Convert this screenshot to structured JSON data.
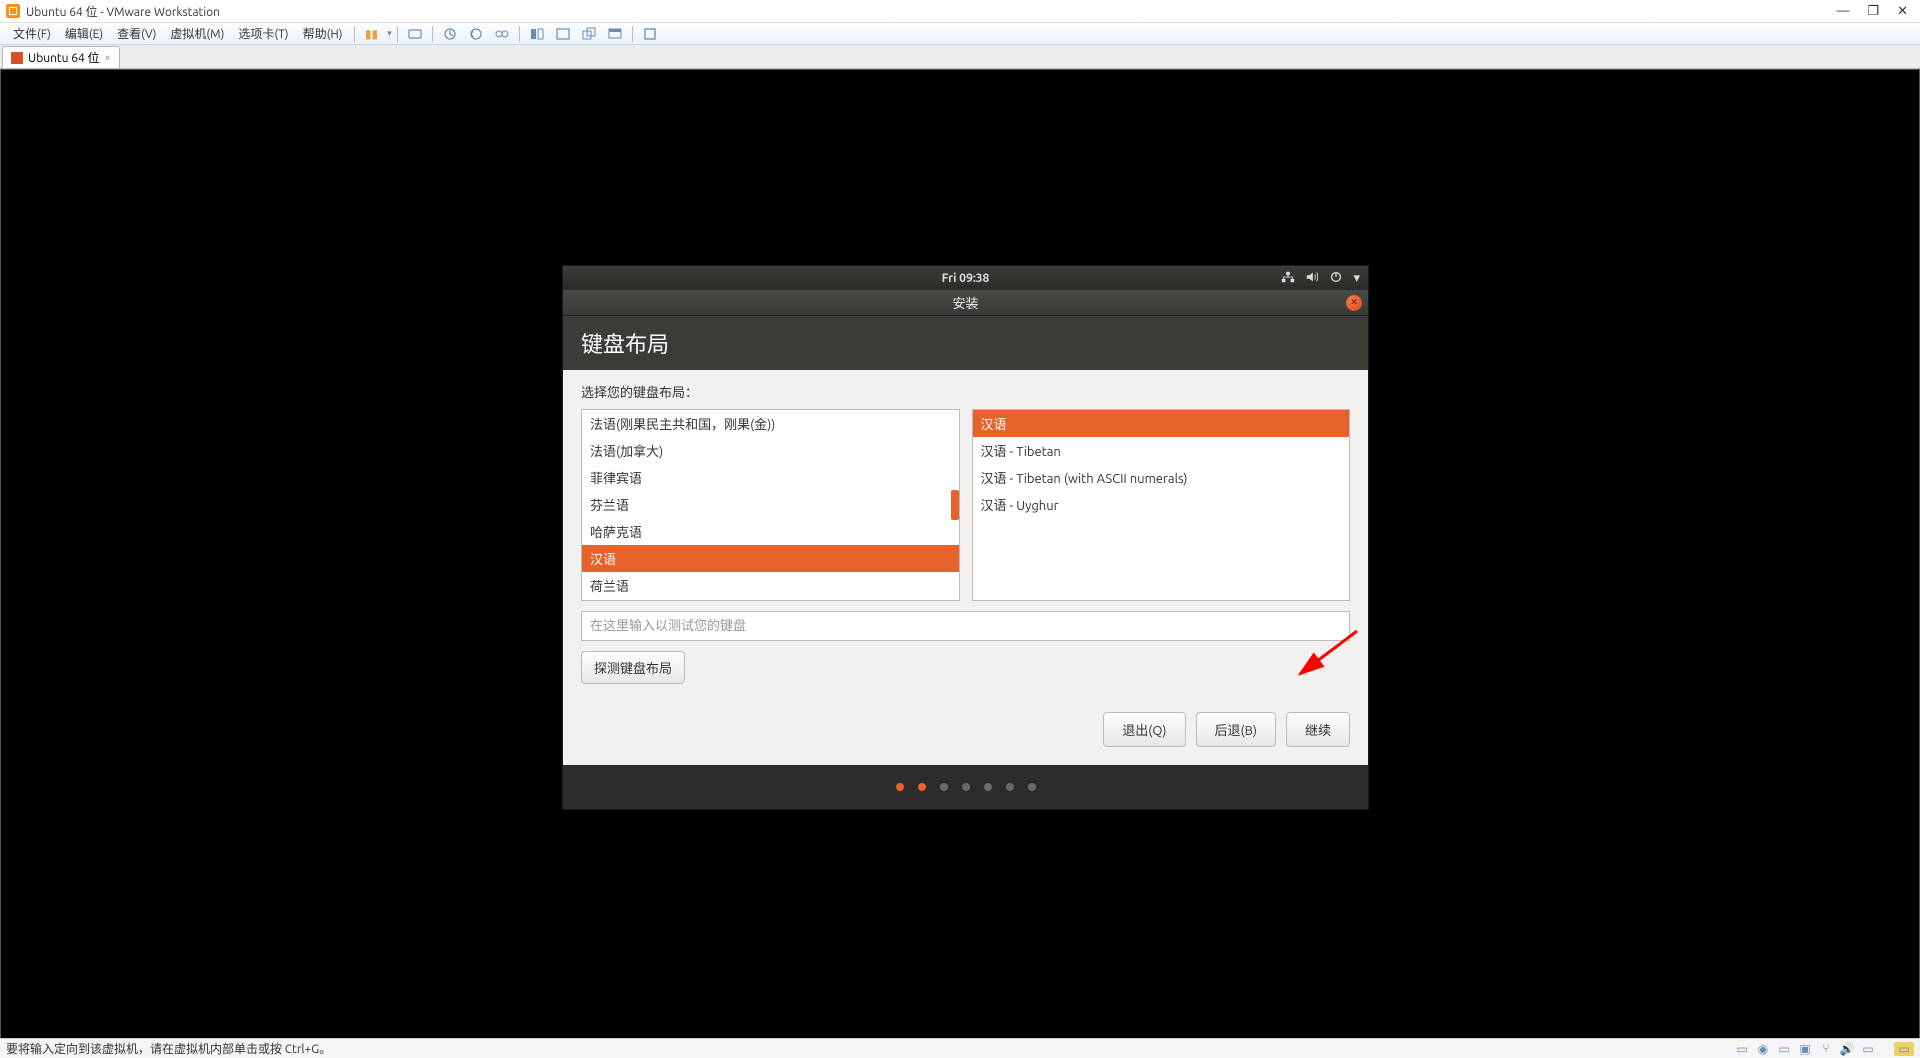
{
  "titlebar": {
    "title": "Ubuntu 64 位 - VMware Workstation"
  },
  "menubar": {
    "items": [
      "文件(F)",
      "编辑(E)",
      "查看(V)",
      "虚拟机(M)",
      "选项卡(T)",
      "帮助(H)"
    ]
  },
  "tab": {
    "label": "Ubuntu 64 位"
  },
  "ubuntu": {
    "time": "Fri 09:38",
    "install_header": "安装",
    "page_title": "键盘布局",
    "choose_label": "选择您的键盘布局：",
    "left_list": [
      "法语(刚果民主共和国，刚果(金))",
      "法语(加拿大)",
      "菲律宾语",
      "芬兰语",
      "哈萨克语",
      "汉语",
      "荷兰语"
    ],
    "left_selected_index": 5,
    "right_list": [
      "汉语",
      "汉语 - Tibetan",
      "汉语 - Tibetan (with ASCII numerals)",
      "汉语 - Uyghur"
    ],
    "right_selected_index": 0,
    "test_placeholder": "在这里输入以测试您的键盘",
    "detect_button": "探测键盘布局",
    "nav": {
      "quit": "退出(Q)",
      "back": "后退(B)",
      "continue": "继续"
    },
    "dots_total": 7,
    "dots_active": [
      0,
      1
    ]
  },
  "statusbar": {
    "hint": "要将输入定向到该虚拟机，请在虚拟机内部单击或按 Ctrl+G。"
  }
}
